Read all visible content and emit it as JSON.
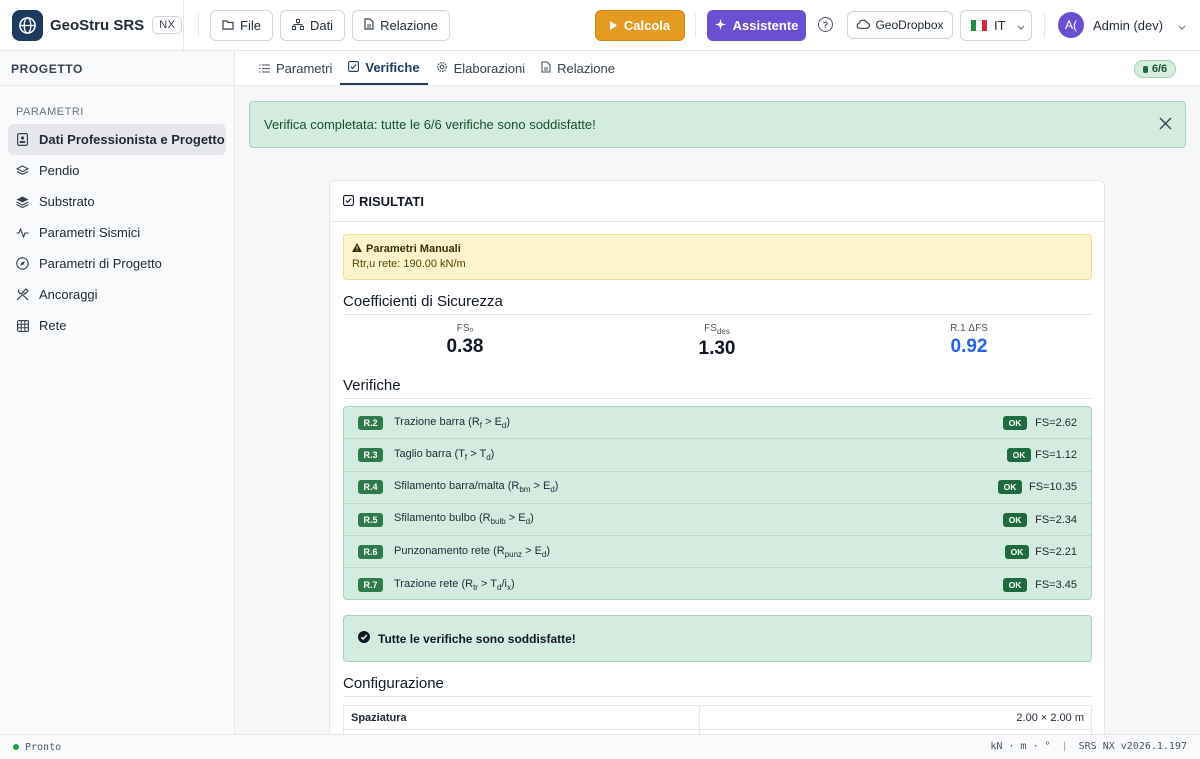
{
  "app": {
    "name": "GeoStru SRS",
    "edition": "NX"
  },
  "toolbar": {
    "file": "File",
    "dati": "Dati",
    "relazione": "Relazione",
    "calcola": "Calcola",
    "assistente": "Assistente",
    "help": "?",
    "geodropbox": "GeoDropbox",
    "language": "IT",
    "user_initials": "A(",
    "user_name": "Admin (dev)"
  },
  "sidebar": {
    "header": "PROGETTO",
    "section": "PARAMETRI",
    "items": [
      {
        "label": "Dati Professionista e Progetto",
        "icon": "badge-icon",
        "active": true
      },
      {
        "label": "Pendio",
        "icon": "layers-outline-icon"
      },
      {
        "label": "Substrato",
        "icon": "layers-filled-icon"
      },
      {
        "label": "Parametri Sismici",
        "icon": "activity-icon"
      },
      {
        "label": "Parametri di Progetto",
        "icon": "compass-icon"
      },
      {
        "label": "Ancoraggi",
        "icon": "tools-icon"
      },
      {
        "label": "Rete",
        "icon": "grid-icon"
      }
    ]
  },
  "tabs": [
    {
      "label": "Parametri",
      "icon": "list-icon"
    },
    {
      "label": "Verifiche",
      "icon": "check-square-icon",
      "active": true
    },
    {
      "label": "Elaborazioni",
      "icon": "cog-icon"
    },
    {
      "label": "Relazione",
      "icon": "document-icon"
    }
  ],
  "count_badge": "6/6",
  "alert": {
    "message": "Verifica completata: tutte le 6/6 verifiche sono soddisfatte!"
  },
  "results": {
    "title": "RISULTATI",
    "warning_title": "Parametri Manuali",
    "warning_text": "Rtr,u rete: 190.00 kN/m",
    "coef_title": "Coefficienti di Sicurezza",
    "coefficients": [
      {
        "label": "FSₒ",
        "value": "0.38"
      },
      {
        "label_main": "FS",
        "label_sub": "des",
        "value": "1.30"
      },
      {
        "label": "R.1 ΔFS",
        "value": "0.92",
        "color": "#2563eb"
      }
    ],
    "verifiche_title": "Verifiche",
    "verifiche": [
      {
        "code": "R.2",
        "desc_pre": "Trazione barra (R",
        "s1": "f",
        "desc_mid": " > E",
        "s2": "d",
        "desc_post": ")",
        "status": "OK",
        "fs": "FS=2.62"
      },
      {
        "code": "R.3",
        "desc_pre": "Taglio barra (T",
        "s1": "f",
        "desc_mid": " > T",
        "s2": "d",
        "desc_post": ")",
        "status": "OK",
        "fs": "FS=1.12"
      },
      {
        "code": "R.4",
        "desc_pre": "Sfilamento barra/malta (R",
        "s1": "bm",
        "desc_mid": " > E",
        "s2": "d",
        "desc_post": ")",
        "status": "OK",
        "fs": "FS=10.35"
      },
      {
        "code": "R.5",
        "desc_pre": "Sfilamento bulbo (R",
        "s1": "bulb",
        "desc_mid": " > E",
        "s2": "d",
        "desc_post": ")",
        "status": "OK",
        "fs": "FS=2.34"
      },
      {
        "code": "R.6",
        "desc_pre": "Punzonamento rete (R",
        "s1": "punz",
        "desc_mid": " > E",
        "s2": "d",
        "desc_post": ")",
        "status": "OK",
        "fs": "FS=2.21"
      },
      {
        "code": "R.7",
        "desc_pre": "Trazione rete (R",
        "s1": "tr",
        "desc_mid": " > T",
        "s2": "d",
        "desc_mid2": "/i",
        "s3": "x",
        "desc_post": ")",
        "status": "OK",
        "fs": "FS=3.45"
      }
    ],
    "all_ok": "Tutte le verifiche sono soddisfatte!",
    "config_title": "Configurazione",
    "config": [
      {
        "label": "Spaziatura",
        "value": "2.00 × 2.00 m"
      }
    ]
  },
  "statusbar": {
    "left": "Pronto",
    "units": "kN · m · °",
    "sep": "|",
    "version": "SRS NX v2026.1.197"
  }
}
